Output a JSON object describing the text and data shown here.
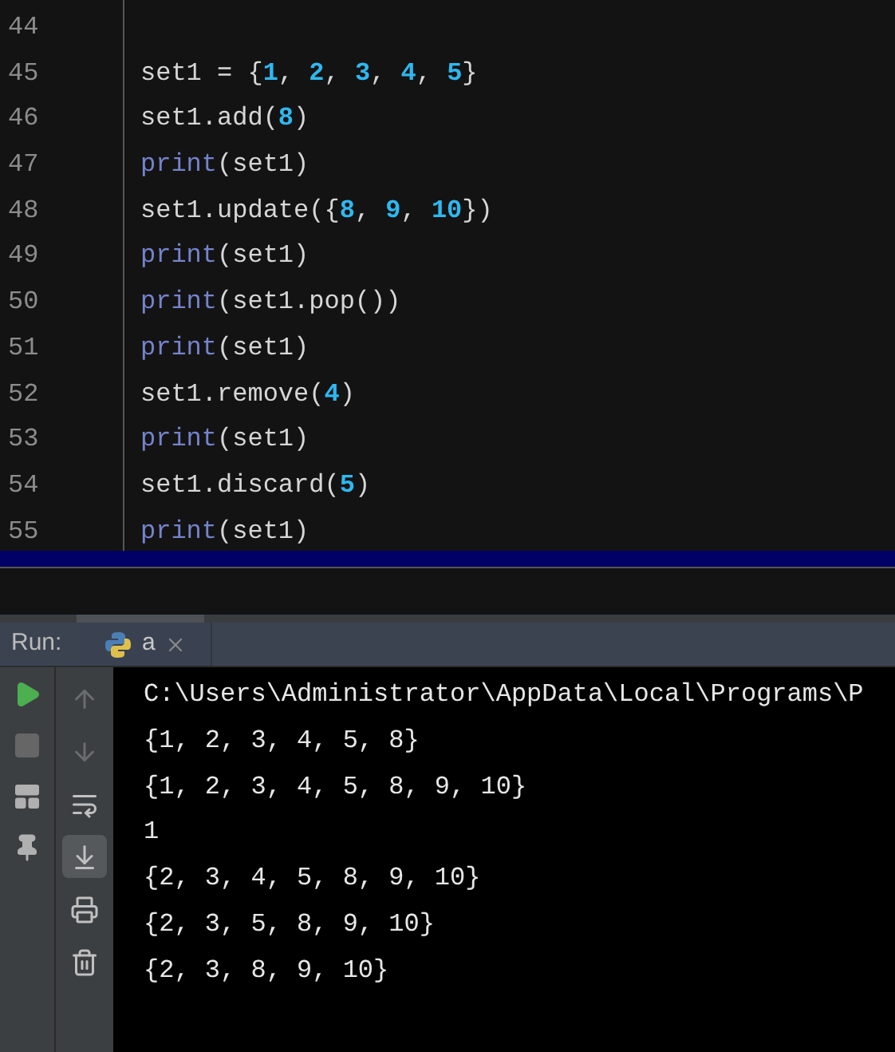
{
  "editor": {
    "lines": [
      {
        "number": "44"
      },
      {
        "number": "45",
        "tokens": [
          {
            "kind": "plain",
            "text": "set1 = {"
          },
          {
            "kind": "number",
            "text": "1"
          },
          {
            "kind": "plain",
            "text": ", "
          },
          {
            "kind": "number",
            "text": "2"
          },
          {
            "kind": "plain",
            "text": ", "
          },
          {
            "kind": "number",
            "text": "3"
          },
          {
            "kind": "plain",
            "text": ", "
          },
          {
            "kind": "number",
            "text": "4"
          },
          {
            "kind": "plain",
            "text": ", "
          },
          {
            "kind": "number",
            "text": "5"
          },
          {
            "kind": "plain",
            "text": "}"
          }
        ]
      },
      {
        "number": "46",
        "tokens": [
          {
            "kind": "plain",
            "text": "set1.add("
          },
          {
            "kind": "number",
            "text": "8"
          },
          {
            "kind": "plain",
            "text": ")"
          }
        ]
      },
      {
        "number": "47",
        "tokens": [
          {
            "kind": "builtin",
            "text": "print"
          },
          {
            "kind": "plain",
            "text": "(set1)"
          }
        ]
      },
      {
        "number": "48",
        "tokens": [
          {
            "kind": "plain",
            "text": "set1.update({"
          },
          {
            "kind": "number",
            "text": "8"
          },
          {
            "kind": "plain",
            "text": ", "
          },
          {
            "kind": "number",
            "text": "9"
          },
          {
            "kind": "plain",
            "text": ", "
          },
          {
            "kind": "number",
            "text": "10"
          },
          {
            "kind": "plain",
            "text": "})"
          }
        ]
      },
      {
        "number": "49",
        "tokens": [
          {
            "kind": "builtin",
            "text": "print"
          },
          {
            "kind": "plain",
            "text": "(set1)"
          }
        ]
      },
      {
        "number": "50",
        "tokens": [
          {
            "kind": "builtin",
            "text": "print"
          },
          {
            "kind": "plain",
            "text": "(set1.pop())"
          }
        ]
      },
      {
        "number": "51",
        "tokens": [
          {
            "kind": "builtin",
            "text": "print"
          },
          {
            "kind": "plain",
            "text": "(set1)"
          }
        ]
      },
      {
        "number": "52",
        "tokens": [
          {
            "kind": "plain",
            "text": "set1.remove("
          },
          {
            "kind": "number",
            "text": "4"
          },
          {
            "kind": "plain",
            "text": ")"
          }
        ]
      },
      {
        "number": "53",
        "tokens": [
          {
            "kind": "builtin",
            "text": "print"
          },
          {
            "kind": "plain",
            "text": "(set1)"
          }
        ]
      },
      {
        "number": "54",
        "tokens": [
          {
            "kind": "plain",
            "text": "set1.discard("
          },
          {
            "kind": "number",
            "text": "5"
          },
          {
            "kind": "plain",
            "text": ")"
          }
        ]
      },
      {
        "number": "55",
        "tokens": [
          {
            "kind": "builtin",
            "text": "print"
          },
          {
            "kind": "plain",
            "text": "(set1)"
          }
        ]
      }
    ]
  },
  "run_panel": {
    "label": "Run:",
    "tabs": [
      {
        "label": "a",
        "selected": true
      }
    ],
    "left_toolbar": [
      {
        "kind": "run",
        "disabled": false
      },
      {
        "kind": "stop",
        "disabled": true
      },
      {
        "kind": "layout",
        "disabled": false
      },
      {
        "kind": "pin",
        "disabled": false
      }
    ],
    "right_toolbar": [
      {
        "kind": "up",
        "disabled": true,
        "on": false
      },
      {
        "kind": "down",
        "disabled": true,
        "on": false
      },
      {
        "kind": "wrap",
        "disabled": false,
        "on": false
      },
      {
        "kind": "scroll_end",
        "disabled": false,
        "on": true
      },
      {
        "kind": "print",
        "disabled": false,
        "on": false
      },
      {
        "kind": "delete",
        "disabled": false,
        "on": false
      }
    ],
    "console": [
      "C:\\Users\\Administrator\\AppData\\Local\\Programs\\P",
      "{1, 2, 3, 4, 5, 8}",
      "{1, 2, 3, 4, 5, 8, 9, 10}",
      "1",
      "{2, 3, 4, 5, 8, 9, 10}",
      "{2, 3, 5, 8, 9, 10}",
      "{2, 3, 8, 9, 10}"
    ]
  }
}
